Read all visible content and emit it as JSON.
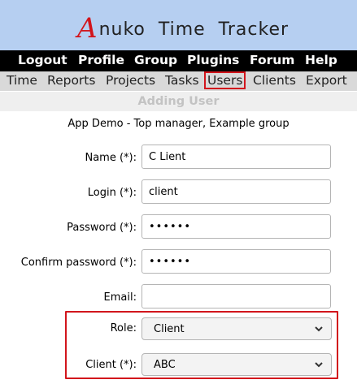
{
  "logo": {
    "initial": "A",
    "rest": "nuko  Time  Tracker"
  },
  "top_menu": [
    "Logout",
    "Profile",
    "Group",
    "Plugins",
    "Forum",
    "Help"
  ],
  "sub_menu": [
    "Time",
    "Reports",
    "Projects",
    "Tasks",
    "Users",
    "Clients",
    "Export"
  ],
  "active_tab": "Users",
  "page_title": "Adding User",
  "group_line": "App Demo - Top manager, Example group",
  "form": {
    "name_label": "Name (*):",
    "name_value": "C Lient",
    "login_label": "Login (*):",
    "login_value": "client",
    "password_label": "Password (*):",
    "password_value": "••••••",
    "confirm_label": "Confirm password (*):",
    "confirm_value": "••••••",
    "email_label": "Email:",
    "email_value": "",
    "role_label": "Role:",
    "role_value": "Client",
    "client_label": "Client (*):",
    "client_value": "ABC"
  },
  "colors": {
    "banner": "#b6cff1",
    "menu": "#000000",
    "submenu": "#d9d9d9",
    "highlight": "#d2151c"
  }
}
